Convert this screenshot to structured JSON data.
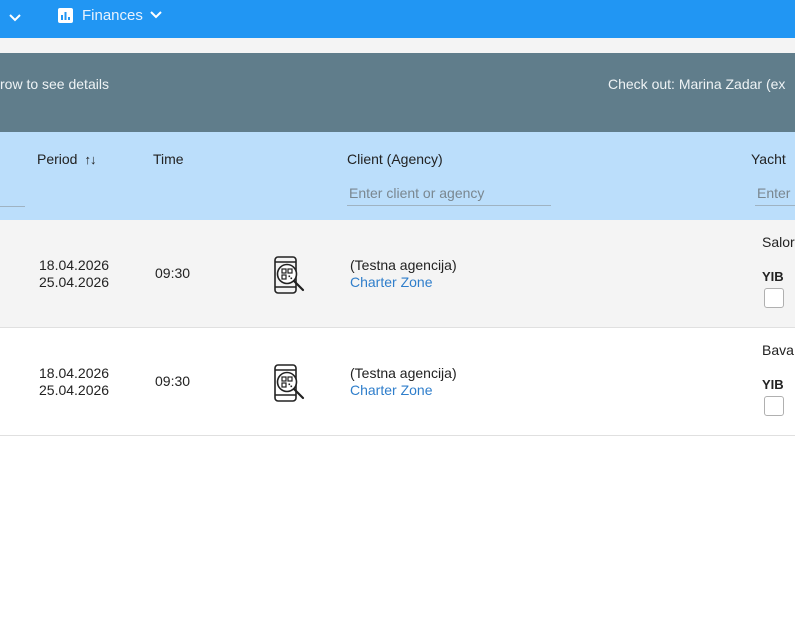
{
  "topbar": {
    "nav_item_finances": "Finances",
    "bg_color": "#2196f3"
  },
  "infobar": {
    "hint": "row to see details",
    "checkout": "Check out:  Marina Zadar (ex",
    "bg_color": "#607d8b"
  },
  "table": {
    "header_bg": "#bbdefb",
    "columns": {
      "period": "Period",
      "period_sort_icon": "↑↓",
      "time": "Time",
      "client": "Client (Agency)",
      "yacht": "Yacht"
    },
    "filters": {
      "client_placeholder": "Enter client or agency",
      "yacht_placeholder": "Enter"
    },
    "rows": [
      {
        "date_from": "18.04.2026",
        "date_to": "25.04.2026",
        "time": "09:30",
        "icon": "qr-phone-scan-icon",
        "client": "(Testna agencija)",
        "agency": "Charter Zone",
        "yacht": "Salor",
        "yacht_badge": "YIB"
      },
      {
        "date_from": "18.04.2026",
        "date_to": "25.04.2026",
        "time": "09:30",
        "icon": "qr-phone-scan-icon",
        "client": "(Testna agencija)",
        "agency": "Charter Zone",
        "yacht": "Bava",
        "yacht_badge": "YIB"
      }
    ]
  }
}
